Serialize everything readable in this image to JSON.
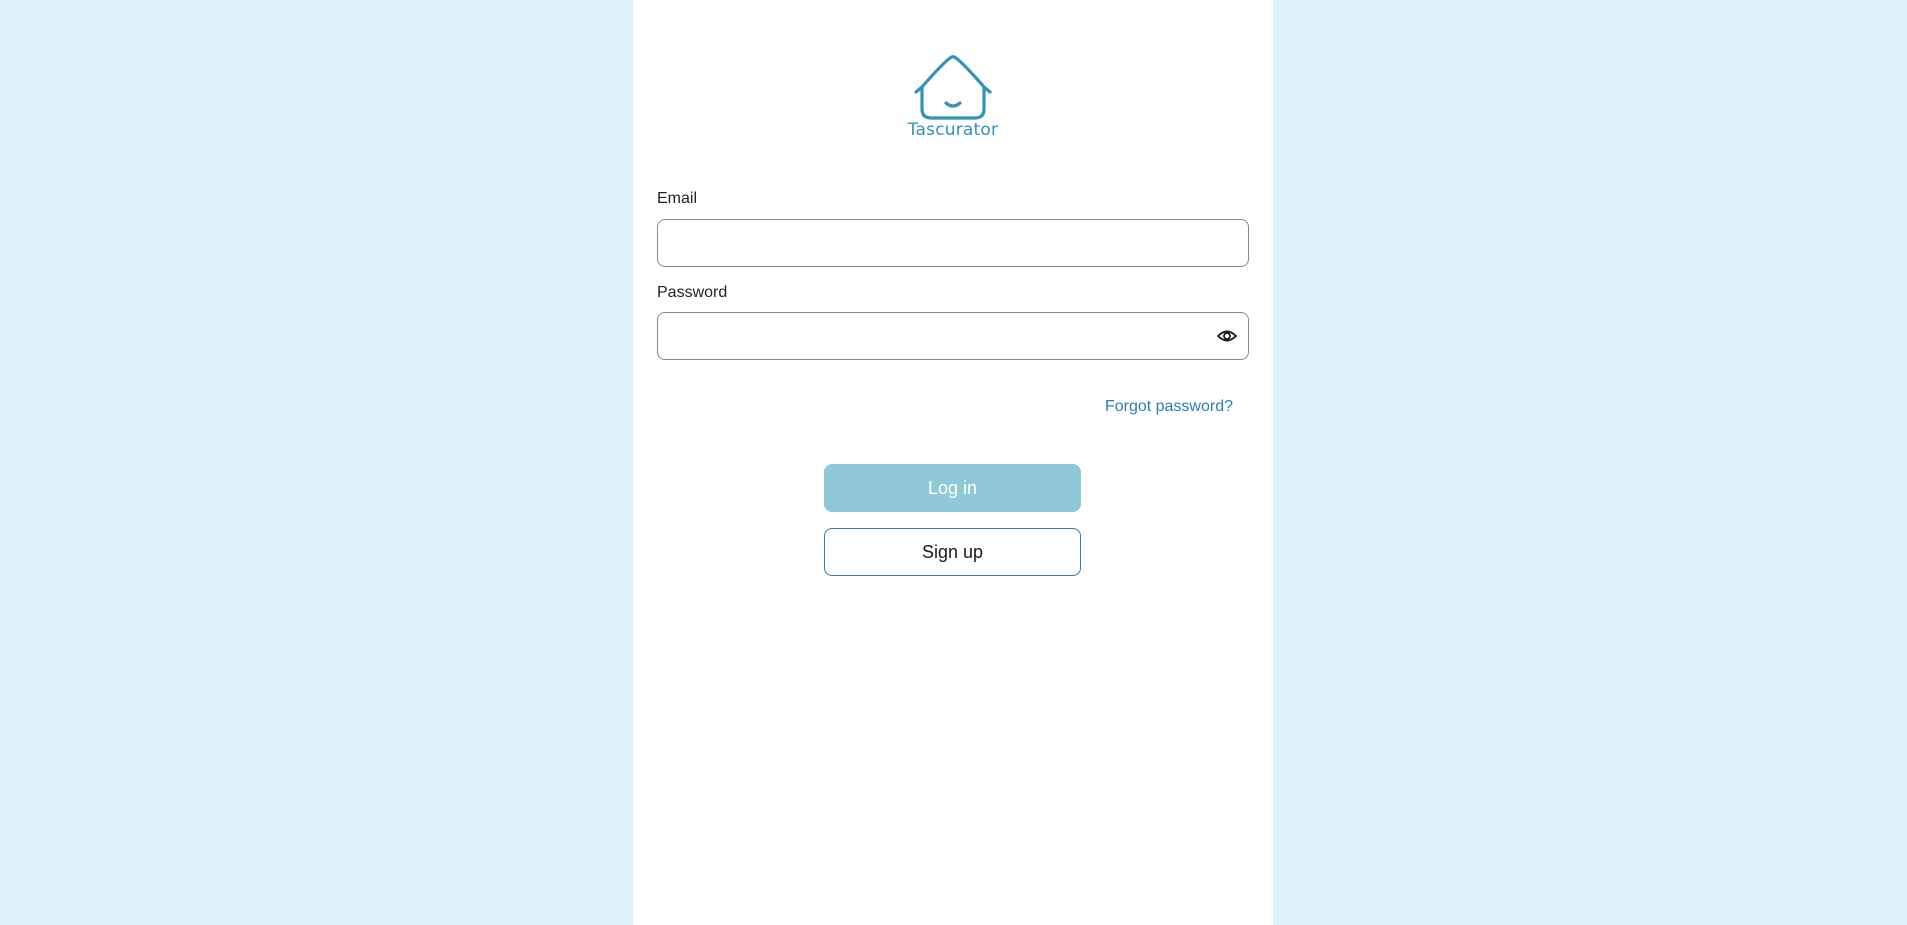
{
  "brand": {
    "name": "Tascurator",
    "logo_icon": "smiling-house-icon",
    "color": "#3491b8"
  },
  "form": {
    "email_label": "Email",
    "email_value": "",
    "password_label": "Password",
    "password_value": "",
    "password_toggle_icon": "eye-icon",
    "forgot_password": "Forgot password?",
    "login_label": "Log in",
    "signup_label": "Sign up"
  },
  "colors": {
    "background": "#dff1fd",
    "panel": "#ffffff",
    "login_button": "#8fc8d8",
    "link": "#2a7fb0",
    "signup_border": "#2d7fa8"
  }
}
